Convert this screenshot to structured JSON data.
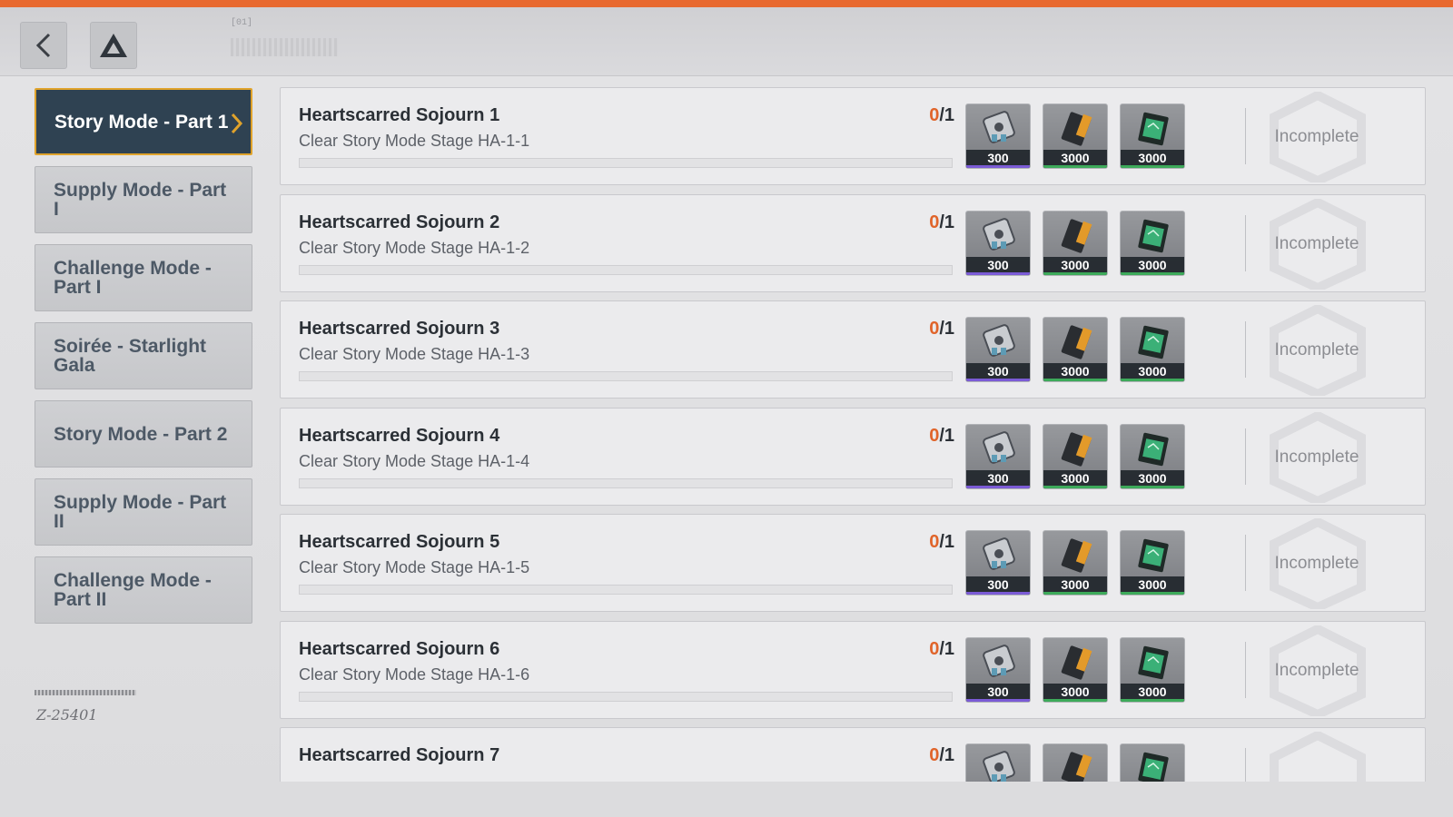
{
  "header": {
    "back_icon": "chevron-left-icon",
    "home_icon": "triangle-logo-icon",
    "code_label": "[01]"
  },
  "sidebar": {
    "items": [
      {
        "label": "Story Mode - Part 1",
        "active": true
      },
      {
        "label": "Supply Mode - Part I",
        "active": false
      },
      {
        "label": "Challenge Mode - Part I",
        "active": false
      },
      {
        "label": "Soirée - Starlight Gala",
        "active": false
      },
      {
        "label": "Story Mode - Part 2",
        "active": false
      },
      {
        "label": "Supply Mode - Part II",
        "active": false
      },
      {
        "label": "Challenge Mode - Part II",
        "active": false
      }
    ]
  },
  "quests": [
    {
      "title": "Heartscarred Sojourn 1",
      "description": "Clear Story Mode Stage HA-1-1",
      "done": "0",
      "total": "/1",
      "progress": 0,
      "status": "Incomplete",
      "rewards": [
        {
          "icon": "module-icon",
          "qty": "300"
        },
        {
          "icon": "orange-battery-icon",
          "qty": "3000"
        },
        {
          "icon": "green-chip-icon",
          "qty": "3000"
        }
      ]
    },
    {
      "title": "Heartscarred Sojourn 2",
      "description": "Clear Story Mode Stage HA-1-2",
      "done": "0",
      "total": "/1",
      "progress": 0,
      "status": "Incomplete",
      "rewards": [
        {
          "icon": "module-icon",
          "qty": "300"
        },
        {
          "icon": "orange-battery-icon",
          "qty": "3000"
        },
        {
          "icon": "green-chip-icon",
          "qty": "3000"
        }
      ]
    },
    {
      "title": "Heartscarred Sojourn 3",
      "description": "Clear Story Mode Stage HA-1-3",
      "done": "0",
      "total": "/1",
      "progress": 0,
      "status": "Incomplete",
      "rewards": [
        {
          "icon": "module-icon",
          "qty": "300"
        },
        {
          "icon": "orange-battery-icon",
          "qty": "3000"
        },
        {
          "icon": "green-chip-icon",
          "qty": "3000"
        }
      ]
    },
    {
      "title": "Heartscarred Sojourn 4",
      "description": "Clear Story Mode Stage HA-1-4",
      "done": "0",
      "total": "/1",
      "progress": 0,
      "status": "Incomplete",
      "rewards": [
        {
          "icon": "module-icon",
          "qty": "300"
        },
        {
          "icon": "orange-battery-icon",
          "qty": "3000"
        },
        {
          "icon": "green-chip-icon",
          "qty": "3000"
        }
      ]
    },
    {
      "title": "Heartscarred Sojourn 5",
      "description": "Clear Story Mode Stage HA-1-5",
      "done": "0",
      "total": "/1",
      "progress": 0,
      "status": "Incomplete",
      "rewards": [
        {
          "icon": "module-icon",
          "qty": "300"
        },
        {
          "icon": "orange-battery-icon",
          "qty": "3000"
        },
        {
          "icon": "green-chip-icon",
          "qty": "3000"
        }
      ]
    },
    {
      "title": "Heartscarred Sojourn 6",
      "description": "Clear Story Mode Stage HA-1-6",
      "done": "0",
      "total": "/1",
      "progress": 0,
      "status": "Incomplete",
      "rewards": [
        {
          "icon": "module-icon",
          "qty": "300"
        },
        {
          "icon": "orange-battery-icon",
          "qty": "3000"
        },
        {
          "icon": "green-chip-icon",
          "qty": "3000"
        }
      ]
    },
    {
      "title": "Heartscarred Sojourn 7",
      "description": "",
      "done": "0",
      "total": "/1",
      "progress": 0,
      "status": "",
      "rewards": [
        {
          "icon": "module-icon",
          "qty": ""
        },
        {
          "icon": "orange-battery-icon",
          "qty": ""
        },
        {
          "icon": "green-chip-icon",
          "qty": ""
        }
      ]
    }
  ],
  "deco": {
    "signature": "Z-25401"
  },
  "colors": {
    "accent_orange": "#e8692f",
    "active_tab_bg": "#2f4252",
    "active_tab_border": "#e0a32b",
    "rare_purple": "#7b5bd6",
    "common_green": "#3daa5a"
  }
}
